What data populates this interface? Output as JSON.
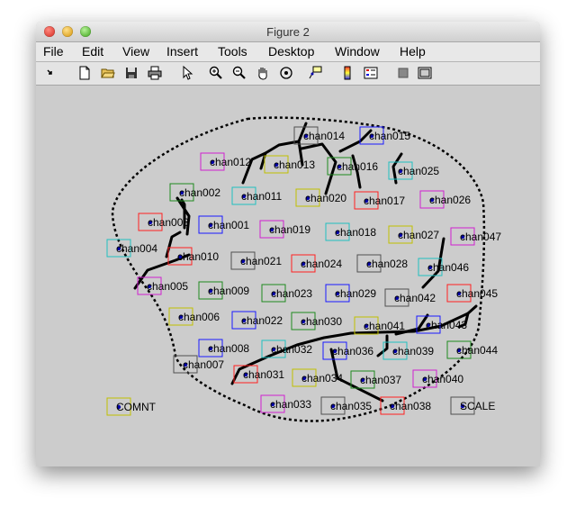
{
  "window": {
    "title": "Figure 2"
  },
  "menu": [
    "File",
    "Edit",
    "View",
    "Insert",
    "Tools",
    "Desktop",
    "Window",
    "Help"
  ],
  "toolbar": {
    "icons": [
      "rotate-arrow-icon",
      "new-document-icon",
      "open-folder-icon",
      "save-icon",
      "print-icon",
      "pointer-arrow-icon",
      "zoom-in-icon",
      "zoom-out-icon",
      "pan-hand-icon",
      "rotate-3d-icon",
      "data-cursor-icon",
      "colorbar-icon",
      "legend-icon",
      "hide-plot-tools-icon",
      "show-plot-tools-icon"
    ]
  },
  "colors": {
    "red": "#ff2020",
    "blue": "#1a1aff",
    "green": "#1e8a1e",
    "cyan": "#20c0c0",
    "magenta": "#d020d0",
    "olive": "#c0c000",
    "gray": "#505050",
    "dot": "#0000a8"
  },
  "channels": [
    {
      "label": "chan014",
      "color": "gray"
    },
    {
      "label": "chan015",
      "color": "blue"
    },
    {
      "label": "chan012",
      "color": "magenta"
    },
    {
      "label": "chan013",
      "color": "olive"
    },
    {
      "label": "chan016",
      "color": "green"
    },
    {
      "label": "chan025",
      "color": "cyan"
    },
    {
      "label": "chan002",
      "color": "green"
    },
    {
      "label": "chan011",
      "color": "cyan"
    },
    {
      "label": "chan020",
      "color": "olive"
    },
    {
      "label": "chan017",
      "color": "red"
    },
    {
      "label": "chan026",
      "color": "magenta"
    },
    {
      "label": "chan003",
      "color": "red"
    },
    {
      "label": "chan001",
      "color": "blue"
    },
    {
      "label": "chan019",
      "color": "magenta"
    },
    {
      "label": "chan018",
      "color": "cyan"
    },
    {
      "label": "chan027",
      "color": "olive"
    },
    {
      "label": "chan047",
      "color": "magenta"
    },
    {
      "label": "chan004",
      "color": "cyan"
    },
    {
      "label": "chan010",
      "color": "red"
    },
    {
      "label": "chan021",
      "color": "gray"
    },
    {
      "label": "chan024",
      "color": "red"
    },
    {
      "label": "chan028",
      "color": "gray"
    },
    {
      "label": "chan046",
      "color": "cyan"
    },
    {
      "label": "chan005",
      "color": "magenta"
    },
    {
      "label": "chan009",
      "color": "green"
    },
    {
      "label": "chan023",
      "color": "green"
    },
    {
      "label": "chan029",
      "color": "blue"
    },
    {
      "label": "chan042",
      "color": "gray"
    },
    {
      "label": "chan045",
      "color": "red"
    },
    {
      "label": "chan006",
      "color": "olive"
    },
    {
      "label": "chan022",
      "color": "blue"
    },
    {
      "label": "chan030",
      "color": "green"
    },
    {
      "label": "chan041",
      "color": "olive"
    },
    {
      "label": "chan043",
      "color": "blue"
    },
    {
      "label": "chan008",
      "color": "blue"
    },
    {
      "label": "chan032",
      "color": "cyan"
    },
    {
      "label": "chan036",
      "color": "blue"
    },
    {
      "label": "chan039",
      "color": "cyan"
    },
    {
      "label": "chan044",
      "color": "green"
    },
    {
      "label": "chan007",
      "color": "gray"
    },
    {
      "label": "chan031",
      "color": "red"
    },
    {
      "label": "chan034",
      "color": "olive"
    },
    {
      "label": "chan037",
      "color": "green"
    },
    {
      "label": "chan040",
      "color": "magenta"
    },
    {
      "label": "chan033",
      "color": "magenta"
    },
    {
      "label": "chan035",
      "color": "gray"
    },
    {
      "label": "chan038",
      "color": "red"
    },
    {
      "label": "COMNT",
      "color": "olive"
    },
    {
      "label": "SCALE",
      "color": "gray"
    }
  ]
}
